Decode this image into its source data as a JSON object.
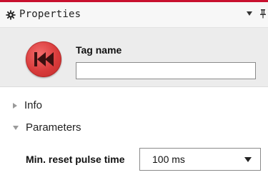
{
  "panel": {
    "title": "Properties",
    "accent_color": "#c8102e",
    "icons": {
      "title_icon": "gear-icon",
      "menu": "chevron-down-icon",
      "pin": "pin-icon"
    }
  },
  "header": {
    "button_icon": "skip-back-icon",
    "button_color": "#d83b3b",
    "tag_name_label": "Tag name",
    "tag_name_value": ""
  },
  "sections": [
    {
      "label": "Info",
      "expanded": false
    },
    {
      "label": "Parameters",
      "expanded": true
    }
  ],
  "parameters": {
    "min_reset_pulse_time": {
      "label": "Min. reset pulse time",
      "selected": "100 ms"
    }
  }
}
